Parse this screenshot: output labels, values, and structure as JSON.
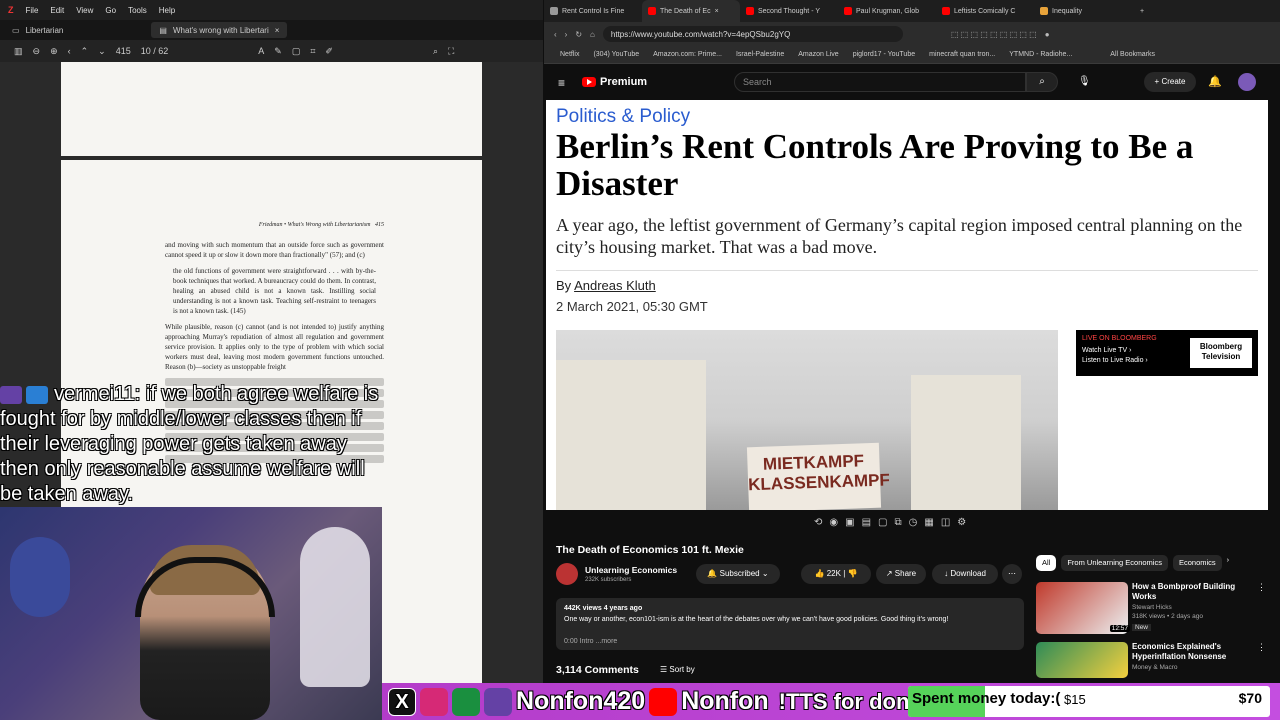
{
  "pdf_viewer": {
    "menu": [
      "File",
      "Edit",
      "View",
      "Go",
      "Tools",
      "Help"
    ],
    "tabs": [
      "Libertarian",
      "What's wrong with Libertari"
    ],
    "page_indicator": "415",
    "page_count": "10 / 62",
    "running_head": "Friedman • What's Wrong with Libertarianism",
    "page_number": "415",
    "paragraph1": "and moving with such momentum that an outside force such as government cannot speed it up or slow it down more than fractionally\" (57); and (c)",
    "quote": "the old functions of government were straightforward . . . with by-the-book techniques that worked. A bureaucracy could do them. In contrast, healing an abused child is not a known task. Instilling social understanding is not a known task. Teaching self-restraint to teenagers is not a known task. (145)",
    "paragraph2": "While plausible, reason (c) cannot (and is not intended to) justify anything approaching Murray's repudiation of almost all regulation and government service provision. It applies only to the type of problem with which social workers must deal, leaving most modern government functions untouched. Reason (b)—society as unstoppable freight"
  },
  "chat": {
    "username": "vermei11:",
    "message": "if we both agree welfare is fought for by middle/lower classes then if their leveraging power gets taken away then only reasonable assume welfare will be taken away."
  },
  "browser": {
    "tabs": [
      {
        "label": "Rent Control Is Fine",
        "color": "#999"
      },
      {
        "label": "The Death of Ec",
        "color": "#f00"
      },
      {
        "label": "Second Thought - Y",
        "color": "#f00"
      },
      {
        "label": "Paul Krugman, Glob",
        "color": "#f00"
      },
      {
        "label": "Leftists Comically C",
        "color": "#f00"
      },
      {
        "label": "Inequality",
        "color": "#e8a33a"
      }
    ],
    "url": "https://www.youtube.com/watch?v=4epQSbu2gYQ",
    "bookmarks": [
      "Netflix",
      "(304) YouTube",
      "Amazon.com: Prime...",
      "Israel-Palestine",
      "Amazon Live",
      "piglord17 - YouTube",
      "minecraft quan tron...",
      "YTMND - Radiohe...",
      "All Bookmarks"
    ]
  },
  "youtube": {
    "logo": "Premium",
    "search_placeholder": "Search",
    "create_label": "Create",
    "video_title": "The Death of Economics 101 ft. Mexie",
    "channel_name": "Unlearning Economics",
    "subscribers": "232K subscribers",
    "subscribed_label": "Subscribed",
    "likes": "22K",
    "share_label": "Share",
    "download_label": "Download",
    "views_line": "442K views  4 years ago",
    "description": "One way or another, econ101-ism is at the heart of the debates over why we can't have good policies. Good thing it's wrong!",
    "desc_more": "0:00 Intro ...more",
    "comments_count": "3,114 Comments",
    "sort_label": "Sort by",
    "chips": [
      "All",
      "From Unlearning Economics",
      "Economics"
    ],
    "recommendations": [
      {
        "title": "How a Bombproof Building Works",
        "channel": "Stewart Hicks",
        "meta": "318K views • 2 days ago",
        "badge": "New",
        "duration": "12:57",
        "thumb": "#c0392b"
      },
      {
        "title": "Economics Explained's Hyperinflation Nonsense",
        "channel": "Money & Macro",
        "meta": "",
        "badge": "",
        "duration": "",
        "thumb": "#2e8b57"
      }
    ]
  },
  "article": {
    "kicker": "Politics & Policy",
    "headline": "Berlin’s Rent Controls Are Proving to Be a Disaster",
    "dek": "A year ago, the leftist government of Germany’s capital region imposed central planning on the city’s housing market. That was a bad move.",
    "by": "By",
    "author": "Andreas Kluth",
    "date": "2 March 2021, 05:30 GMT",
    "sign_text": "MIETKAMPF KLASSENKAMPF",
    "bloomberg_live": "LIVE ON BLOOMBERG",
    "watch_live": "Watch Live TV ›",
    "listen_live": "Listen to Live Radio ›",
    "bloomberg_logo": "Bloomberg Television"
  },
  "stream_bar": {
    "handle1": "Nonfon420",
    "handle2": "Nonfon",
    "tts": "!TTS for dono link",
    "goal_label": "Spent money today:(",
    "goal_current": "$15",
    "goal_max": "$70",
    "goal_fraction": 0.214,
    "icon_colors": [
      "#111",
      "#d62976",
      "#1a8f3f",
      "#6441a5",
      "#f00"
    ]
  }
}
